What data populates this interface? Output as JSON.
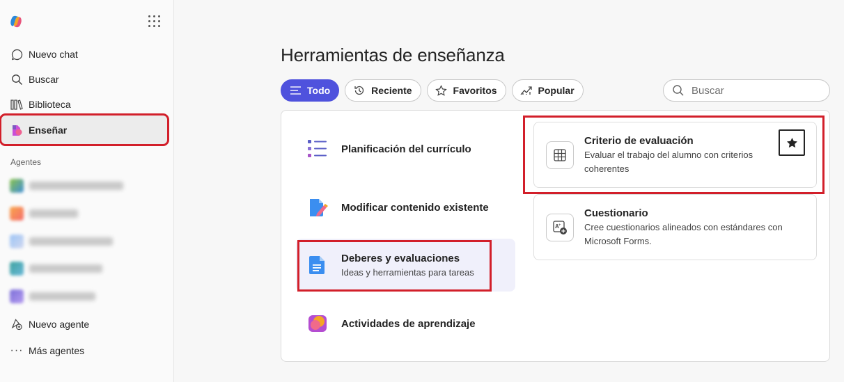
{
  "sidebar": {
    "nav": [
      {
        "label": "Nuevo chat",
        "icon": "chat-icon"
      },
      {
        "label": "Buscar",
        "icon": "search-icon"
      },
      {
        "label": "Biblioteca",
        "icon": "library-icon"
      },
      {
        "label": "Enseñar",
        "icon": "teach-icon"
      }
    ],
    "agents_label": "Agentes",
    "new_agent": "Nuevo agente",
    "more_agents": "Más agentes"
  },
  "main": {
    "title": "Herramientas de enseñanza",
    "filters": [
      {
        "label": "Todo",
        "icon": "list-icon",
        "selected": true
      },
      {
        "label": "Reciente",
        "icon": "history-icon"
      },
      {
        "label": "Favoritos",
        "icon": "star-icon"
      },
      {
        "label": "Popular",
        "icon": "trending-icon"
      }
    ],
    "search_placeholder": "Buscar",
    "categories": [
      {
        "title": "Planificación del currículo"
      },
      {
        "title": "Modificar contenido existente"
      },
      {
        "title": "Deberes y evaluaciones",
        "subtitle": "Ideas y herramientas para tareas"
      },
      {
        "title": "Actividades de aprendizaje"
      }
    ],
    "cards": [
      {
        "title": "Criterio de evaluación",
        "description": "Evaluar el trabajo del alumno con criterios coherentes"
      },
      {
        "title": "Cuestionario",
        "description": "Cree cuestionarios alineados con estándares con Microsoft Forms."
      }
    ]
  },
  "colors": {
    "accent": "#4f52dd",
    "highlight": "#d21f2a"
  }
}
